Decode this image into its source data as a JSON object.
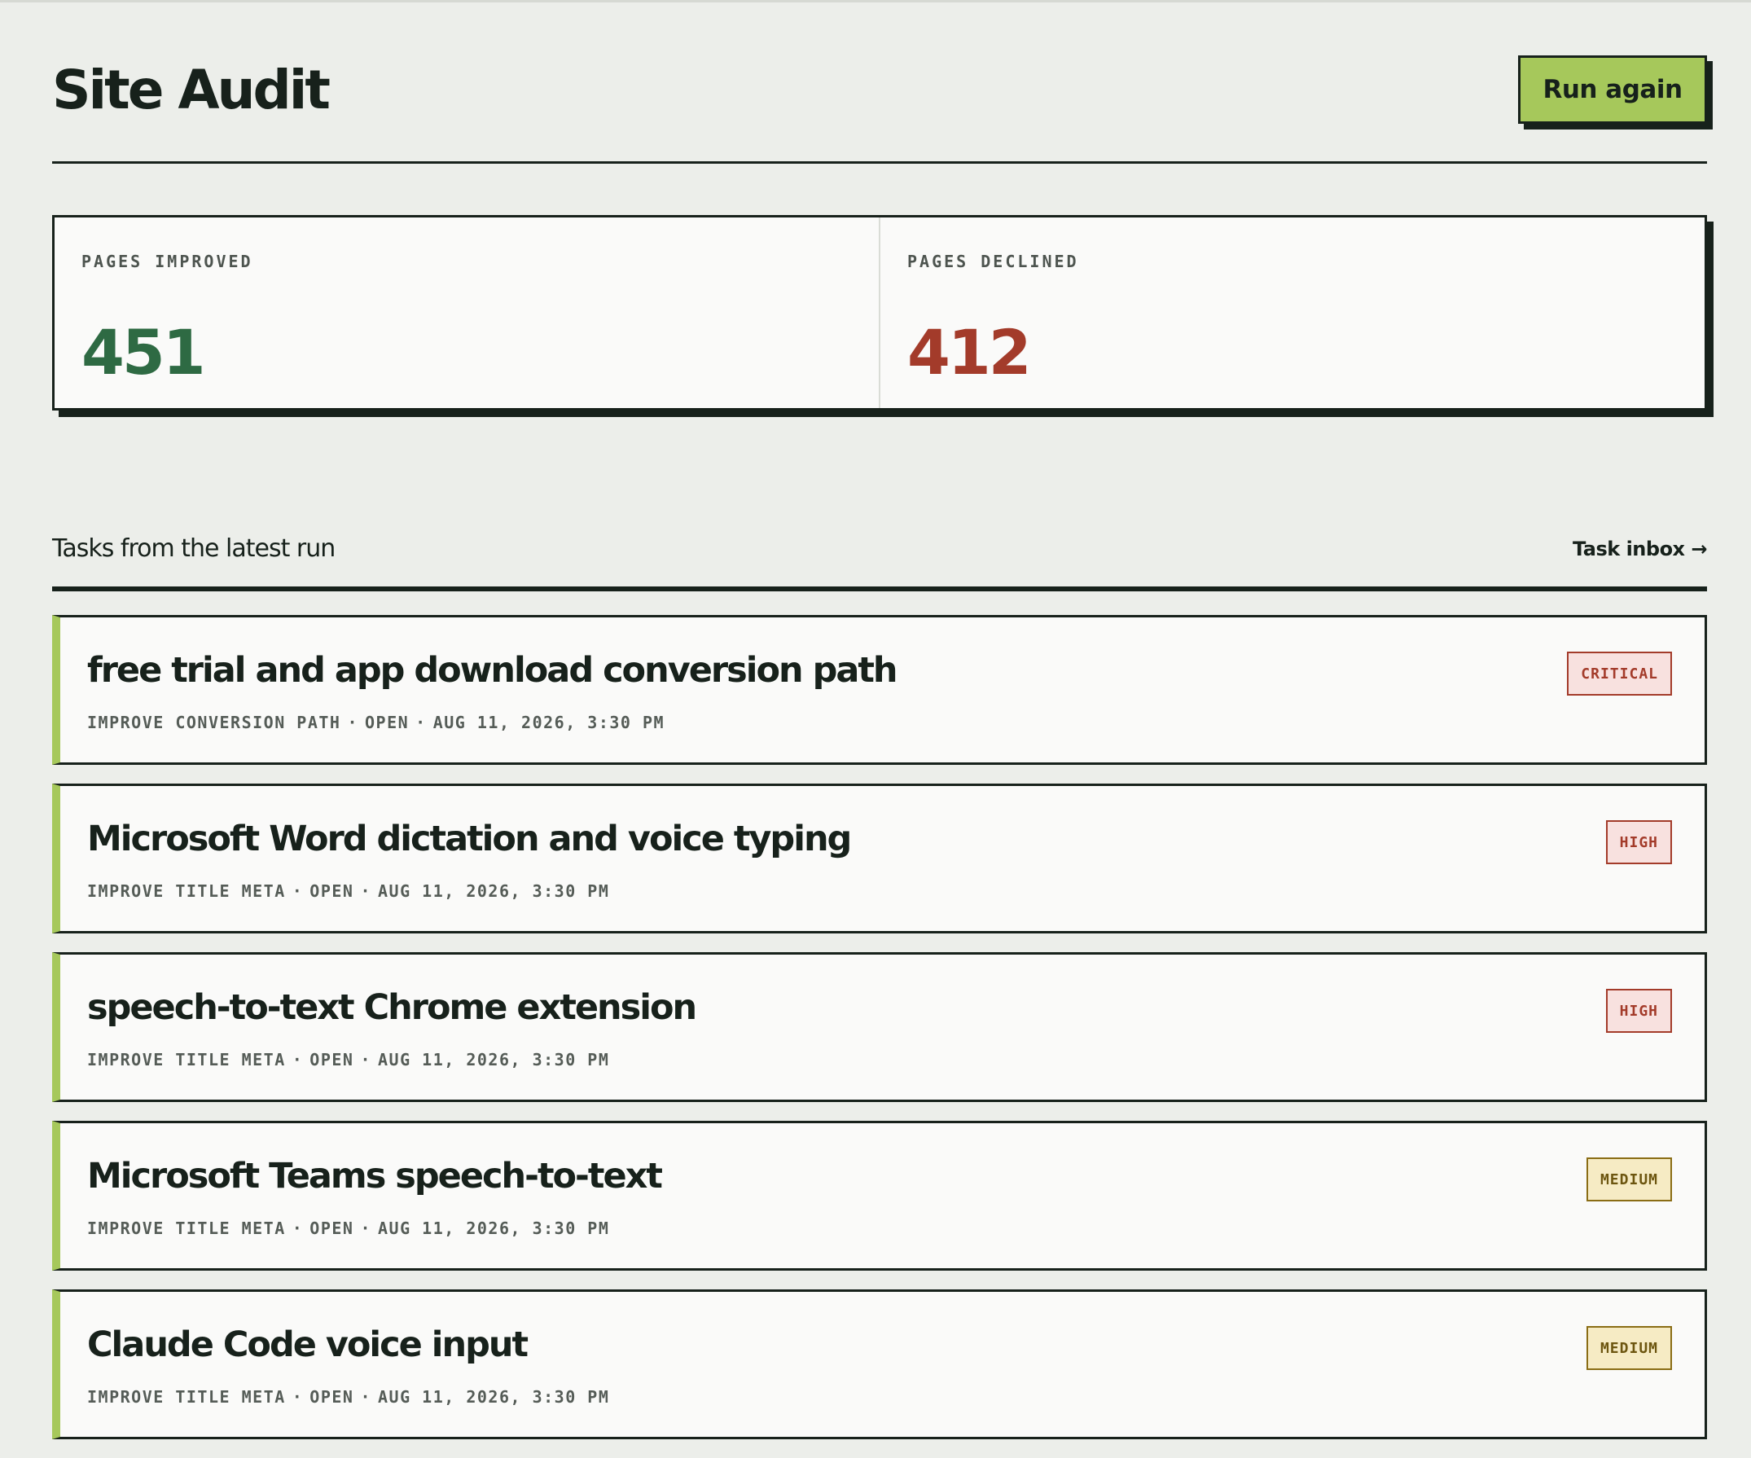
{
  "header": {
    "title": "Site Audit",
    "run_again_label": "Run again"
  },
  "stats": [
    {
      "label": "PAGES IMPROVED",
      "value": "451",
      "tone": "good"
    },
    {
      "label": "PAGES DECLINED",
      "value": "412",
      "tone": "bad"
    }
  ],
  "tasks_section": {
    "title": "Tasks from the latest run",
    "inbox_link": "Task inbox →"
  },
  "tasks": [
    {
      "title": "free trial and app download conversion path",
      "type": "IMPROVE CONVERSION PATH",
      "status": "OPEN",
      "timestamp": "AUG 11, 2026, 3:30 PM",
      "priority": "CRITICAL",
      "priority_level": "critical"
    },
    {
      "title": "Microsoft Word dictation and voice typing",
      "type": "IMPROVE TITLE META",
      "status": "OPEN",
      "timestamp": "AUG 11, 2026, 3:30 PM",
      "priority": "HIGH",
      "priority_level": "high"
    },
    {
      "title": "speech-to-text Chrome extension",
      "type": "IMPROVE TITLE META",
      "status": "OPEN",
      "timestamp": "AUG 11, 2026, 3:30 PM",
      "priority": "HIGH",
      "priority_level": "high"
    },
    {
      "title": "Microsoft Teams speech-to-text",
      "type": "IMPROVE TITLE META",
      "status": "OPEN",
      "timestamp": "AUG 11, 2026, 3:30 PM",
      "priority": "MEDIUM",
      "priority_level": "medium"
    },
    {
      "title": "Claude Code voice input",
      "type": "IMPROVE TITLE META",
      "status": "OPEN",
      "timestamp": "AUG 11, 2026, 3:30 PM",
      "priority": "MEDIUM",
      "priority_level": "medium"
    }
  ],
  "colors": {
    "background": "#eceeea",
    "ink": "#17211b",
    "accent_green": "#a6c85b",
    "improved": "#2e6a43",
    "declined": "#a33b2a",
    "badge_red_bg": "#f8e1df",
    "badge_yellow_bg": "#f6ebc4"
  }
}
